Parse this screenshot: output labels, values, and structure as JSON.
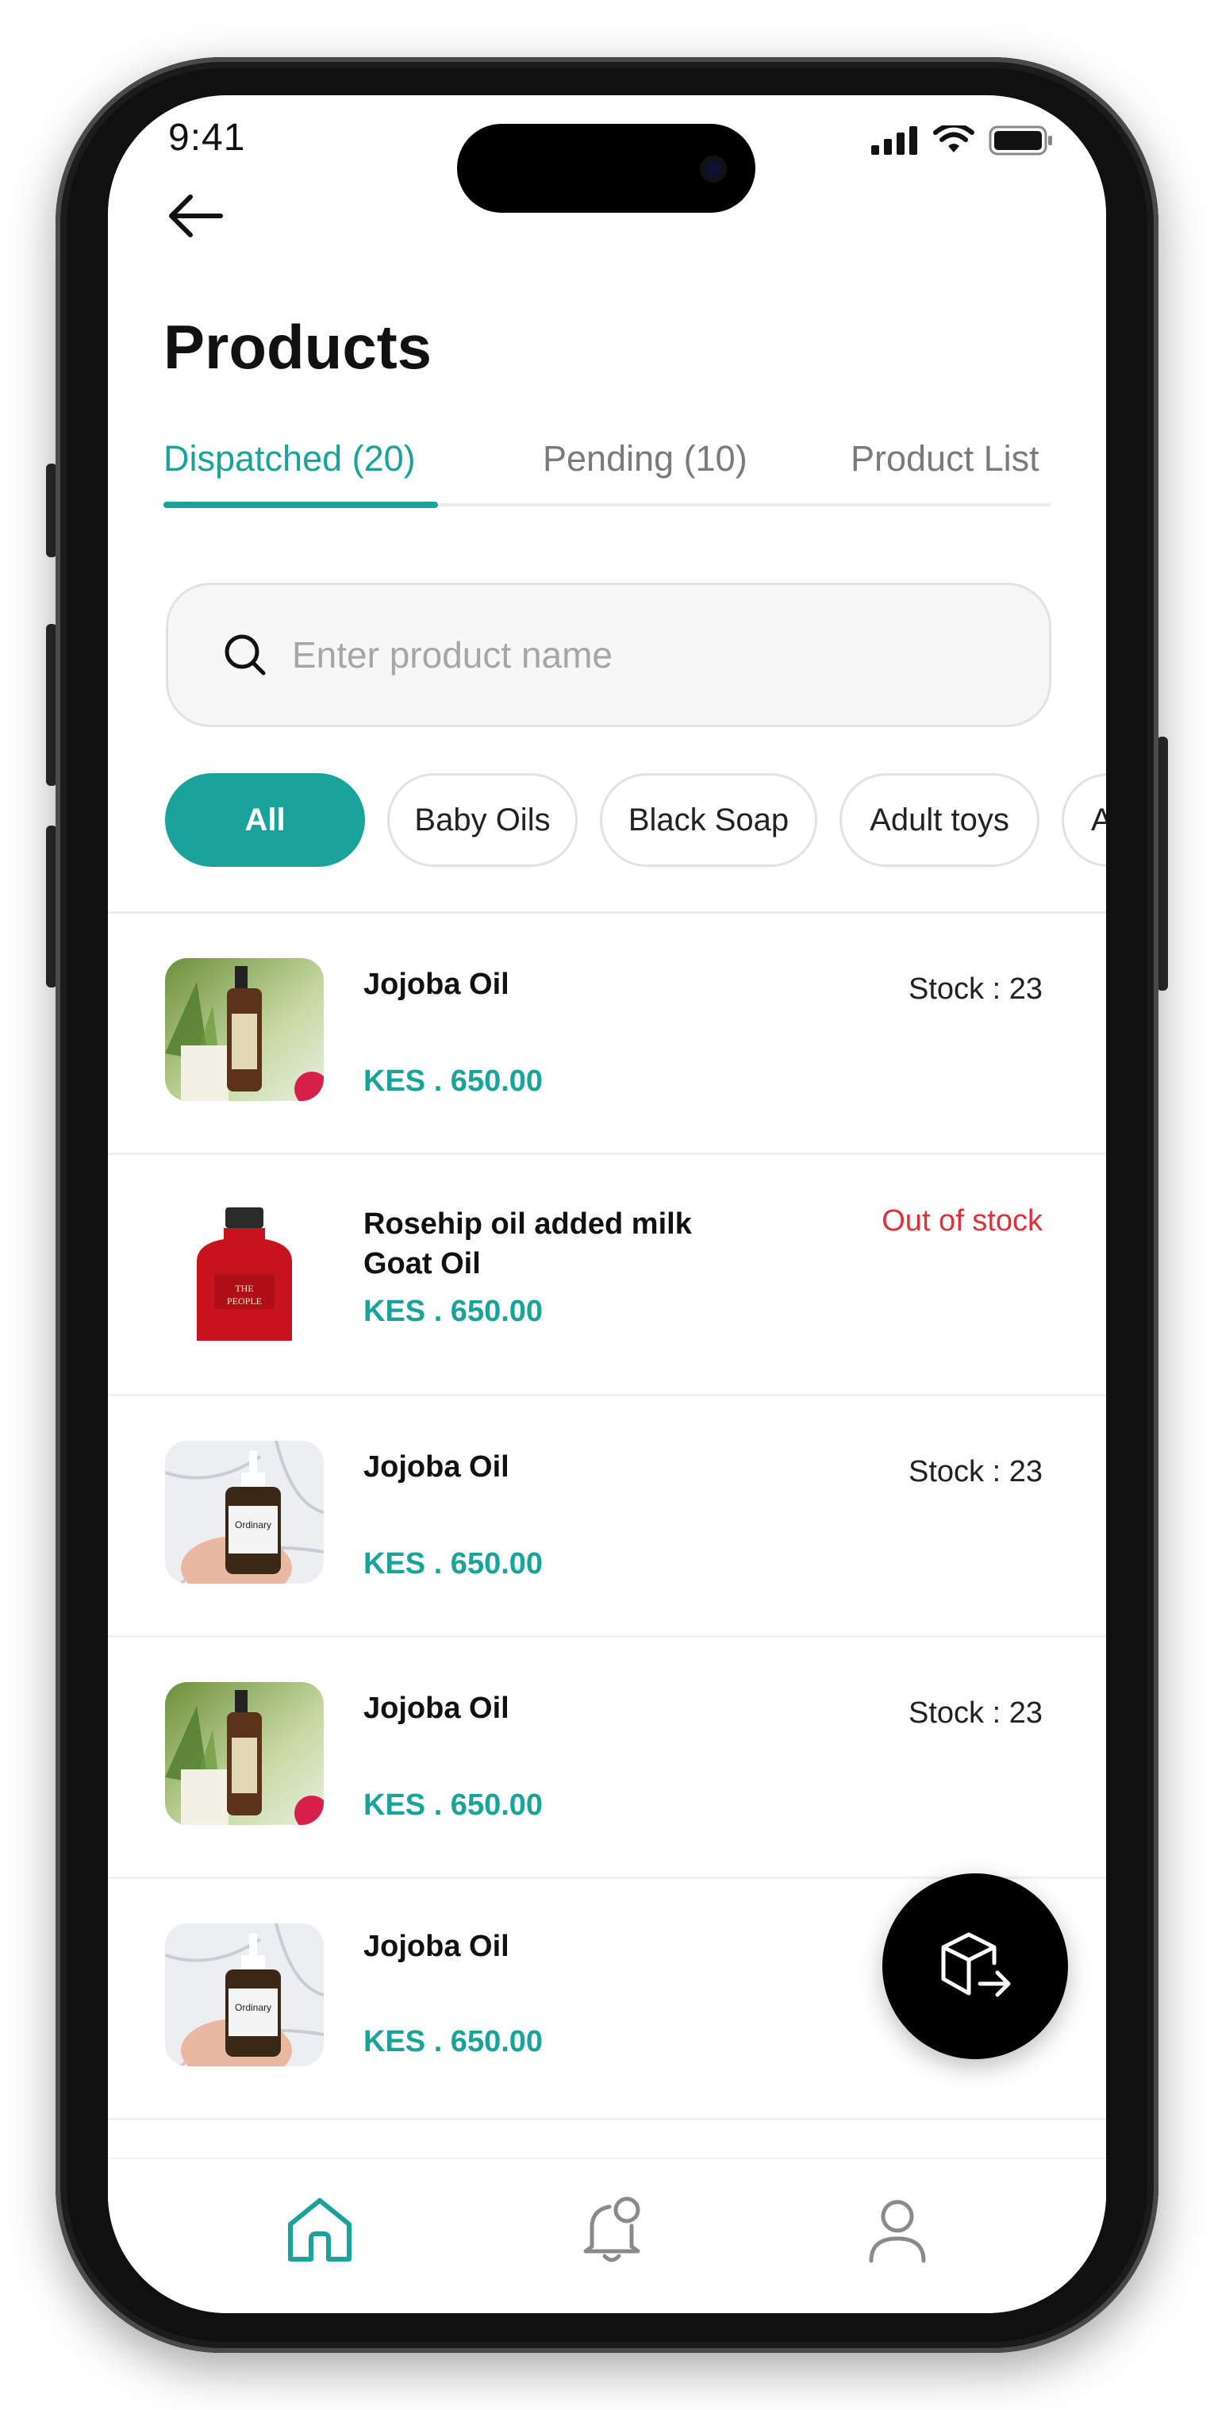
{
  "status_bar": {
    "time": "9:41"
  },
  "header": {
    "title": "Products"
  },
  "tabs": [
    {
      "label": "Dispatched  (20)",
      "active": true
    },
    {
      "label": "Pending (10)",
      "active": false
    },
    {
      "label": "Product List",
      "active": false
    }
  ],
  "search": {
    "placeholder": "Enter product name",
    "value": ""
  },
  "categories": [
    {
      "label": "All",
      "active": true
    },
    {
      "label": "Baby Oils",
      "active": false
    },
    {
      "label": "Black Soap",
      "active": false
    },
    {
      "label": "Adult toys",
      "active": false
    },
    {
      "label": "A",
      "active": false
    }
  ],
  "products": [
    {
      "name": "Jojoba Oil",
      "price": "KES . 650.00",
      "stock": "Stock : 23",
      "image": "spray-bottle-aloe"
    },
    {
      "name": "Rosehip oil added milk Goat Oil",
      "price": "KES . 650.00",
      "stock": "Out of stock",
      "image": "red-bottle"
    },
    {
      "name": "Jojoba Oil",
      "price": "KES . 650.00",
      "stock": "Stock : 23",
      "image": "dropper-bottle-marble"
    },
    {
      "name": "Jojoba Oil",
      "price": "KES . 650.00",
      "stock": "Stock : 23",
      "image": "spray-bottle-aloe"
    },
    {
      "name": "Jojoba Oil",
      "price": "KES . 650.00",
      "stock": "",
      "image": "dropper-bottle-marble"
    }
  ],
  "fab": {
    "icon": "box-arrow-right-icon"
  },
  "bottom_nav": [
    {
      "icon": "home-icon",
      "active": true
    },
    {
      "icon": "bell-icon",
      "active": false
    },
    {
      "icon": "user-icon",
      "active": false
    }
  ],
  "colors": {
    "accent": "#1aa39a",
    "out_of_stock": "#e0303a",
    "text": "#111111"
  }
}
